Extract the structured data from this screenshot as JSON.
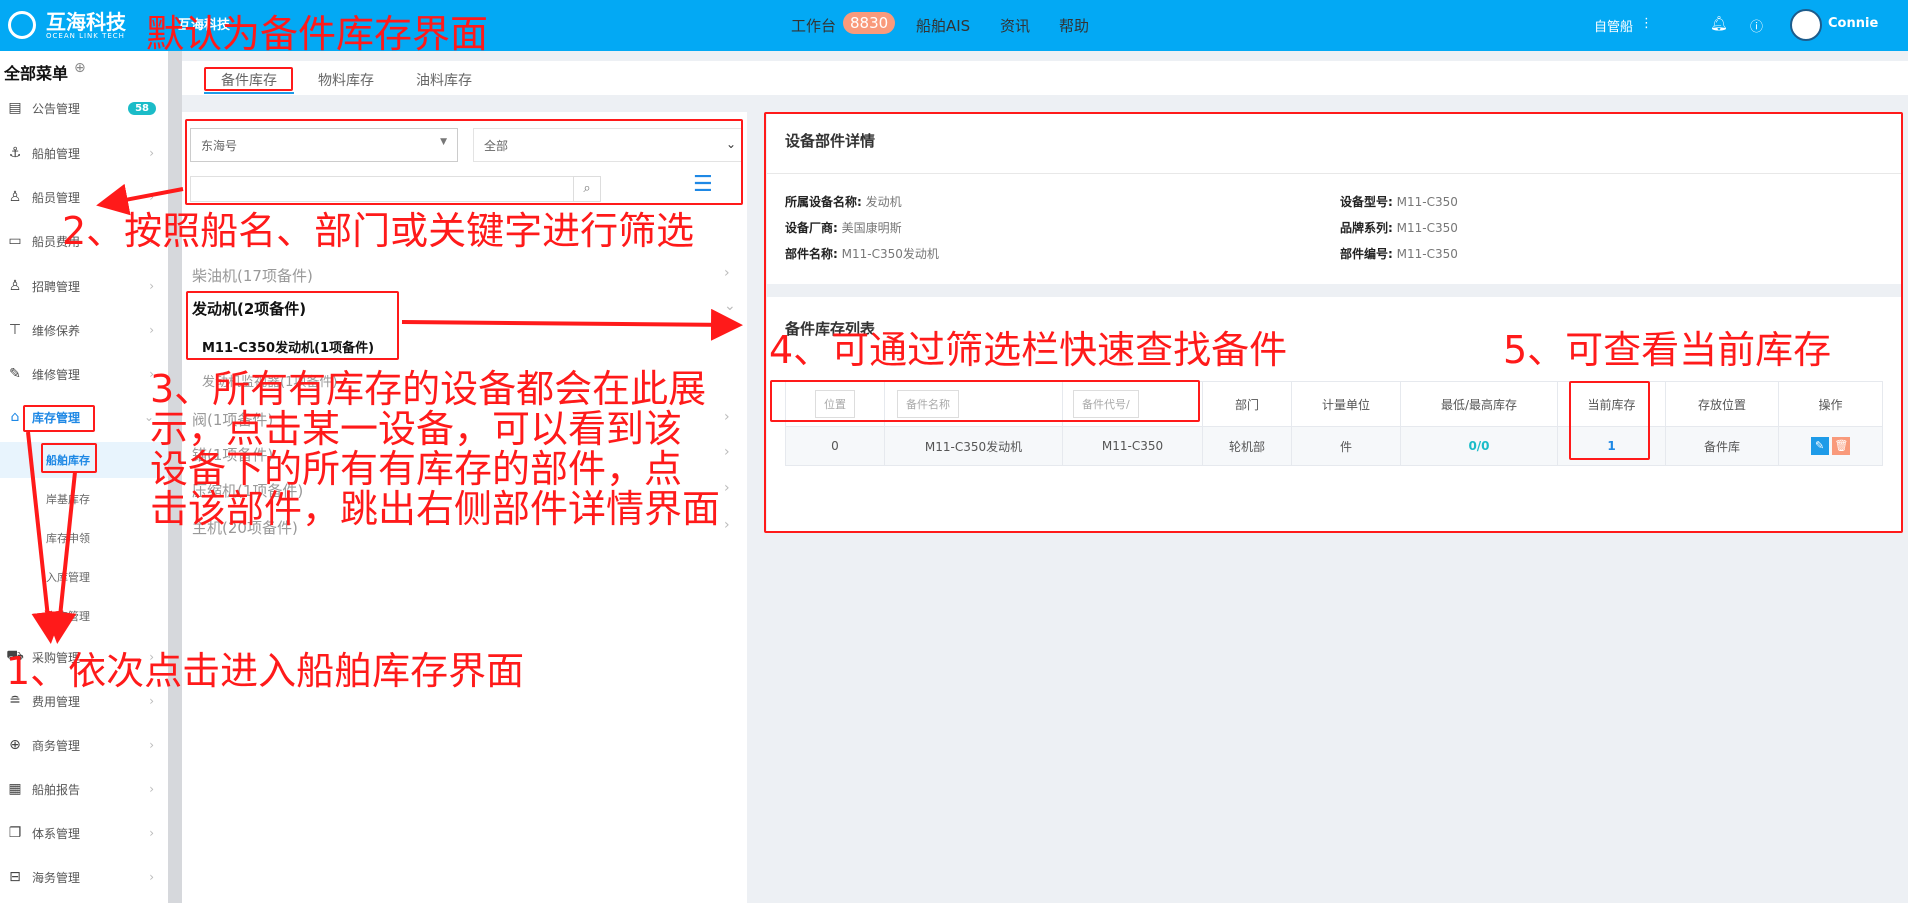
{
  "header": {
    "brand": "互海科技",
    "brand_sub": "OCEAN LINK TECH",
    "brand_small": "互海科技",
    "nav": [
      {
        "label": "工作台",
        "badge": "8830"
      },
      {
        "label": "船舶AIS"
      },
      {
        "label": "资讯"
      },
      {
        "label": "帮助"
      }
    ],
    "ship_mode": "自管船",
    "user": "Connie",
    "color": "#03a9f4"
  },
  "sidebar": {
    "title": "全部菜单",
    "items": [
      {
        "label": "公告管理",
        "icon": "book-icon",
        "badge": "58"
      },
      {
        "label": "船舶管理",
        "icon": "anchor-icon"
      },
      {
        "label": "船员管理",
        "icon": "user-icon"
      },
      {
        "label": "船员费用",
        "icon": "wallet-icon"
      },
      {
        "label": "招聘管理",
        "icon": "user-add-icon"
      },
      {
        "label": "维修保养",
        "icon": "hammer-icon"
      },
      {
        "label": "维修管理",
        "icon": "wrench-icon"
      },
      {
        "label": "库存管理",
        "icon": "home-icon"
      },
      {
        "label": "采购管理",
        "icon": "cart-icon"
      },
      {
        "label": "费用管理",
        "icon": "coins-icon"
      },
      {
        "label": "商务管理",
        "icon": "globe-icon"
      },
      {
        "label": "船舶报告",
        "icon": "calendar-icon"
      },
      {
        "label": "体系管理",
        "icon": "files-icon"
      },
      {
        "label": "海务管理",
        "icon": "ship-icon"
      }
    ],
    "sub_items": [
      "船舶库存",
      "岸基库存",
      "库存申领",
      "入库管理",
      "出库管理"
    ]
  },
  "tabs": [
    "备件库存",
    "物料库存",
    "油料库存"
  ],
  "filter": {
    "ship": "东海号",
    "department": "全部",
    "keyword": ""
  },
  "equipment_list": {
    "items": [
      "柴油机(17项备件)",
      "发动机(2项备件)",
      "M11-C350发动机(1项备件)",
      "发动机监视器(1项备件)",
      "阀(1项备件)",
      "锚(1项备件)",
      "压缩机(1项备件)",
      "主机(20项备件)"
    ]
  },
  "detail": {
    "title": "设备部件详情",
    "fields": [
      {
        "label": "所属设备名称:",
        "value": "发动机"
      },
      {
        "label": "设备型号:",
        "value": "M11-C350"
      },
      {
        "label": "设备厂商:",
        "value": "美国康明斯"
      },
      {
        "label": "品牌系列:",
        "value": "M11-C350"
      },
      {
        "label": "部件名称:",
        "value": "M11-C350发动机"
      },
      {
        "label": "部件编号:",
        "value": "M11-C350"
      }
    ]
  },
  "stock": {
    "title": "备件库存列表",
    "filter_placeholders": [
      "位置",
      "备件名称",
      "备件代号/"
    ],
    "headers": [
      "部门",
      "计量单位",
      "最低/最高库存",
      "当前库存",
      "存放位置",
      "操作"
    ],
    "rows": [
      [
        "0",
        "M11-C350发动机",
        "M11-C350",
        "轮机部",
        "件",
        "0/0",
        "1",
        "备件库"
      ]
    ]
  },
  "annotations": {
    "a0": "默认为备件库存界面",
    "a1": "1、依次点击进入船舶库存界面",
    "a2": "2、按照船名、部门或关键字进行筛选",
    "a3": [
      "3、所有有库存的设备都会在此展",
      "示，点击某一设备，可以看到该",
      "设备下的所有有库存的部件，点",
      "击该部件，跳出右侧部件详情界面"
    ],
    "a4": "4、可通过筛选栏快速查找备件",
    "a5": "5、可查看当前库存"
  }
}
